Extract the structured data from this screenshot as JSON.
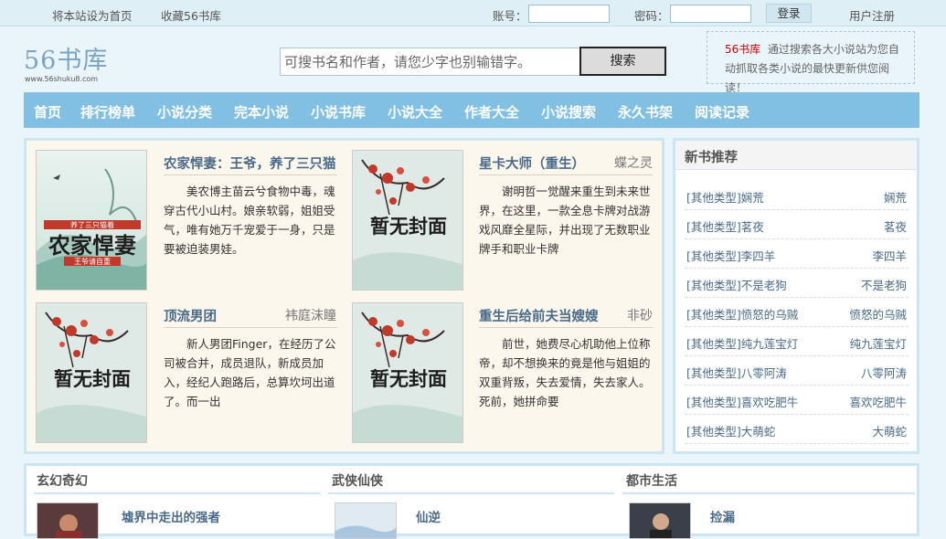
{
  "topbar": {
    "set_home": "将本站设为首页",
    "bookmark": "收藏56书库",
    "account_label": "账号：",
    "password_label": "密码：",
    "login_button": "登录",
    "register": "用户注册"
  },
  "header": {
    "logo": "56书库",
    "logo_url": "www.56shuku8.com",
    "search_placeholder": "可搜书名和作者，请您少字也别输错字。",
    "search_button": "搜索",
    "promo_site": "56书库",
    "promo_text": "通过搜索各大小说站为您自动抓取各类小说的最快更新供您阅读！"
  },
  "nav": [
    "首页",
    "排行榜单",
    "小说分类",
    "完本小说",
    "小说书库",
    "小说大全",
    "作者大全",
    "小说搜索",
    "永久书架",
    "阅读记录"
  ],
  "featured": [
    {
      "title": "农家悍妻：王爷，养了三只猫",
      "author": "",
      "desc": "美农博主苗云兮食物中毒，魂穿古代小山村。娘亲软弱，姐姐受气，唯有她万千宠爱于一身，只是要被迫装男娃。",
      "cover": "custom"
    },
    {
      "title": "星卡大师（重生）",
      "author": "蝶之灵",
      "desc": "谢明哲一觉醒来重生到未来世界，在这里，一款全息卡牌对战游戏风靡全星际，并出现了无数职业牌手和职业卡牌",
      "cover": "暂无封面"
    },
    {
      "title": "顶流男团",
      "author": "袆庭沫瞳",
      "desc": "新人男团Finger，在经历了公司被合并，成员退队，新成员加入，经纪人跑路后，总算坎坷出道了。而一出",
      "cover": "暂无封面"
    },
    {
      "title": "重生后给前夫当嫂嫂",
      "author": "非砂",
      "desc": "前世，她费尽心机助他上位称帝，却不想换来的竟是他与姐姐的双重背叛，失去爱情，失去家人。死前，她拼命要",
      "cover": "暂无封面"
    }
  ],
  "cover_custom": {
    "top": "养了三只猫着",
    "main": "农家悍妻",
    "sub": "王爷请自重"
  },
  "sidebar": {
    "title": "新书推荐",
    "items": [
      {
        "category": "[其他类型]",
        "name": "娴荒",
        "author": "娴荒"
      },
      {
        "category": "[其他类型]",
        "name": "茗夜",
        "author": "茗夜"
      },
      {
        "category": "[其他类型]",
        "name": "李四羊",
        "author": "李四羊"
      },
      {
        "category": "[其他类型]",
        "name": "不是老狗",
        "author": "不是老狗"
      },
      {
        "category": "[其他类型]",
        "name": "愤怒的乌贼",
        "author": "愤怒的乌贼"
      },
      {
        "category": "[其他类型]",
        "name": "纯九莲宝灯",
        "author": "纯九莲宝灯"
      },
      {
        "category": "[其他类型]",
        "name": "八零阿涛",
        "author": "八零阿涛"
      },
      {
        "category": "[其他类型]",
        "name": "喜欢吃肥牛",
        "author": "喜欢吃肥牛"
      },
      {
        "category": "[其他类型]",
        "name": "大萌蛇",
        "author": "大萌蛇"
      }
    ]
  },
  "categories": [
    {
      "name": "玄幻奇幻",
      "book": "墟界中走出的强者"
    },
    {
      "name": "武侠仙侠",
      "book": "仙逆"
    },
    {
      "name": "都市生活",
      "book": "捡漏"
    }
  ]
}
